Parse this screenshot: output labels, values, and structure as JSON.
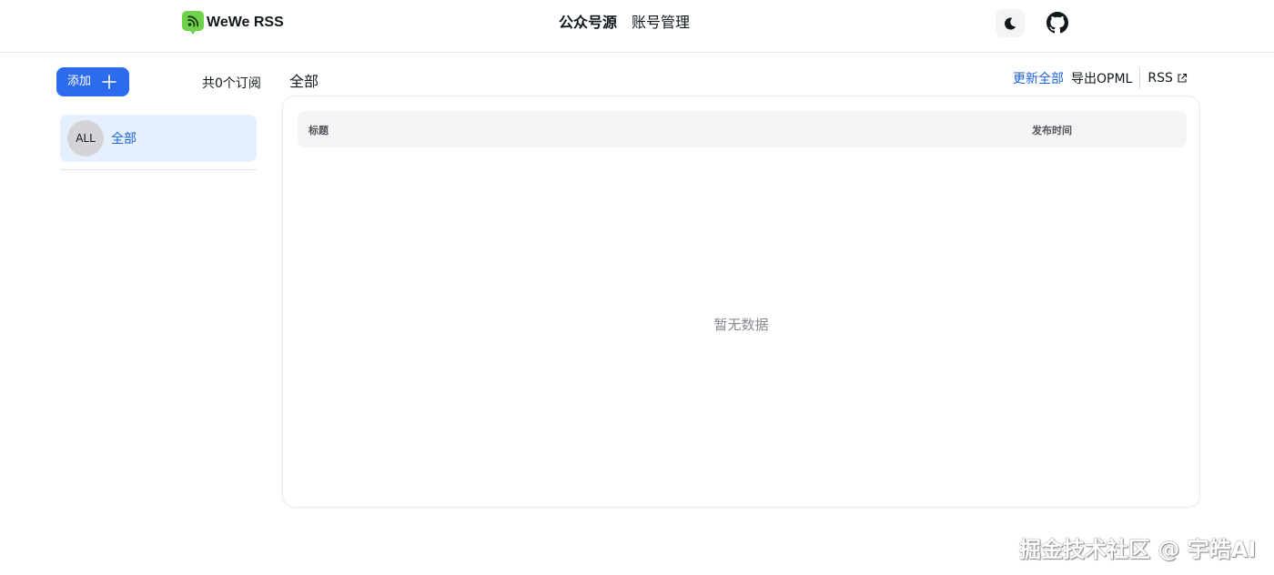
{
  "header": {
    "brand": "WeWe RSS",
    "nav": [
      {
        "label": "公众号源",
        "active": true
      },
      {
        "label": "账号管理",
        "active": false
      }
    ],
    "theme_icon": "moon-icon",
    "github_icon": "github-icon"
  },
  "sidebar": {
    "add_label": "添加",
    "subscription_count": "共0个订阅",
    "items": [
      {
        "avatar": "ALL",
        "label": "全部",
        "selected": true
      }
    ]
  },
  "main": {
    "title": "全部",
    "actions": {
      "update_all": "更新全部",
      "export_opml": "导出OPML",
      "rss": "RSS"
    },
    "table": {
      "columns": [
        "标题",
        "发布时间"
      ],
      "rows": [],
      "empty_text": "暂无数据"
    }
  },
  "watermark": "掘金技术社区 @ 宇皓AI",
  "colors": {
    "primary": "#2c6bef",
    "link": "#1d63d8",
    "selected_bg": "#e6effe",
    "logo_green": "#6fd24a"
  }
}
